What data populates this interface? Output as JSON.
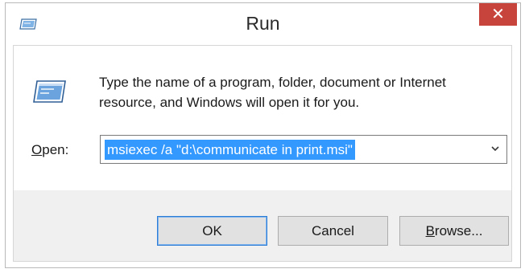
{
  "window": {
    "title": "Run",
    "close_glyph": "✕"
  },
  "icons": {
    "app": "run-icon",
    "body": "run-icon",
    "dropdown": "chevron-down-icon",
    "close": "close-icon"
  },
  "prompt": {
    "text": "Type the name of a program, folder, document or Internet resource, and Windows will open it for you."
  },
  "open": {
    "label_accel": "O",
    "label_rest": "pen:",
    "value": "msiexec /a \"d:\\communicate in print.msi\""
  },
  "buttons": {
    "ok": "OK",
    "cancel": "Cancel",
    "browse_accel": "B",
    "browse_rest": "rowse..."
  },
  "colors": {
    "close_button": "#c7443d",
    "selection": "#3399ff",
    "default_button_border": "#2d7dd4",
    "button_bar": "#f0f0f0"
  }
}
